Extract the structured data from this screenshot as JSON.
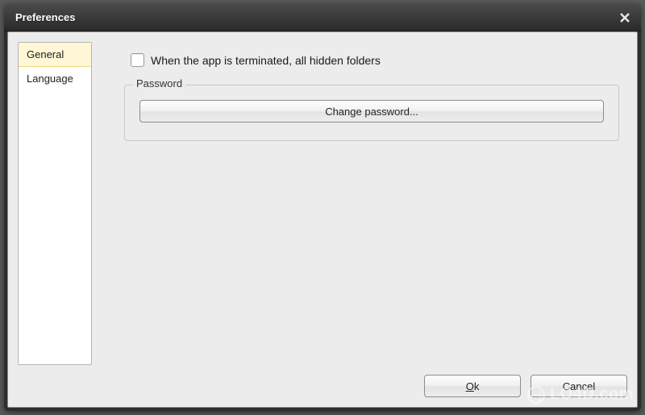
{
  "window": {
    "title": "Preferences"
  },
  "sidebar": {
    "items": [
      {
        "label": "General",
        "active": true
      },
      {
        "label": "Language",
        "active": false
      }
    ]
  },
  "general": {
    "terminate_checkbox_label": "When the app is terminated, all hidden folders",
    "terminate_checked": false,
    "password_group_label": "Password",
    "change_password_label": "Change password..."
  },
  "buttons": {
    "ok": "Ok",
    "cancel": "Cancel"
  },
  "watermark": "LO4D.com"
}
